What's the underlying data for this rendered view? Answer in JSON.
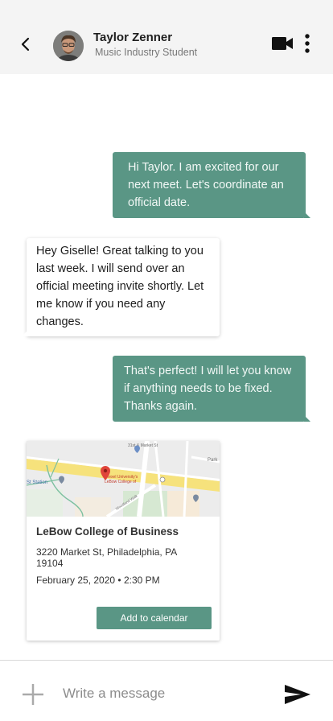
{
  "header": {
    "name": "Taylor Zenner",
    "subtitle": "Music Industry Student"
  },
  "messages": [
    {
      "direction": "out",
      "text": "Hi Taylor. I am excited for our next meet. Let's coordinate an official date."
    },
    {
      "direction": "in",
      "text": "Hey Giselle! Great talking to you last week. I will send over an official meeting invite shortly. Let me know if you need any changes."
    },
    {
      "direction": "out",
      "text": "That's perfect! I will let you know if anything needs to be fixed. Thanks again."
    }
  ],
  "event_card": {
    "map": {
      "street_label": "31st & Market St",
      "park_label": "Park",
      "station_label": "St Station",
      "pin_label_line1": "Drexel University's",
      "pin_label_line2": "LeBow College of",
      "road_label": "Woodland Walk"
    },
    "place_name": "LeBow College of Business",
    "address": "3220 Market St, Philadelphia, PA 19104",
    "date": "February 25, 2020",
    "time": "2:30 PM",
    "button_label": "Add to calendar"
  },
  "composer": {
    "placeholder": "Write a message"
  },
  "colors": {
    "accent": "#5a9685",
    "header_bg": "#f4f4f4"
  }
}
